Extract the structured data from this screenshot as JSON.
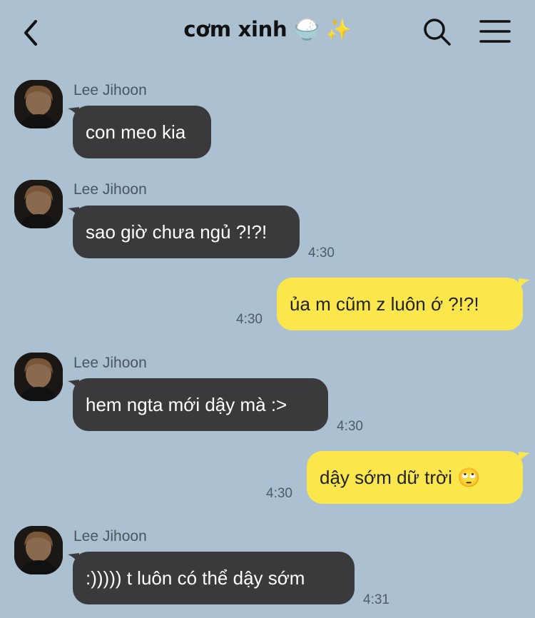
{
  "header": {
    "back_icon": "chevron-left-icon",
    "title": "cơm xinh",
    "title_emoji": "🍚 ✨",
    "search_icon": "search-icon",
    "menu_icon": "hamburger-menu-icon"
  },
  "colors": {
    "background": "#abc1d1",
    "incoming_bubble": "#3a3a3c",
    "outgoing_bubble": "#fbe74c"
  },
  "messages": [
    {
      "sender": "Lee Jihoon",
      "text": "con meo kia",
      "time": ""
    },
    {
      "sender": "Lee Jihoon",
      "text": "sao giờ chưa ngủ ?!?!",
      "time": "4:30"
    },
    {
      "sender": "",
      "text": "ủa m cũm z luôn ớ ?!?!",
      "time": "4:30",
      "outgoing": true
    },
    {
      "sender": "Lee Jihoon",
      "text": "hem ngta mới dậy mà :>",
      "time": "4:30"
    },
    {
      "sender": "",
      "text": "dậy sớm dữ trời 🙄",
      "time": "4:30",
      "outgoing": true
    },
    {
      "sender": "Lee Jihoon",
      "text": ":))))) t luôn có thể dậy sớm",
      "time": "4:31"
    }
  ]
}
